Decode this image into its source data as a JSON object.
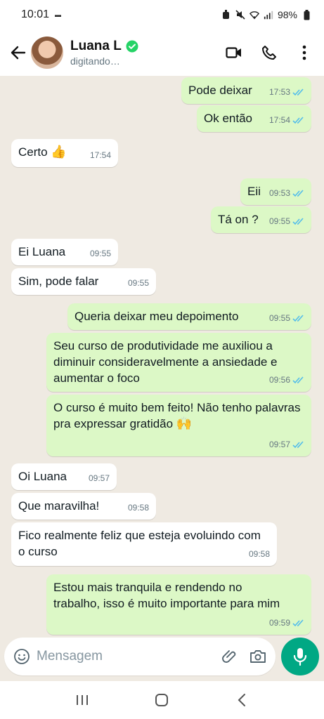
{
  "status_bar": {
    "time": "10:01",
    "battery": "98%",
    "icons": [
      "alarm-icon",
      "mute-icon",
      "wifi-icon",
      "signal-icon",
      "battery-icon"
    ]
  },
  "header": {
    "contact_name": "Luana L",
    "status": "digitando…"
  },
  "messages": [
    {
      "dir": "out",
      "text": "Pode deixar",
      "time": "17:53",
      "read": true
    },
    {
      "dir": "out",
      "text": "Ok então",
      "time": "17:54",
      "read": true
    },
    {
      "dir": "in",
      "text": "Certo",
      "emoji": "👍",
      "time": "17:54"
    },
    {
      "dir": "out",
      "text": "Eii",
      "time": "09:53",
      "read": true
    },
    {
      "dir": "out",
      "text": "Tá on ?",
      "time": "09:55",
      "read": true
    },
    {
      "dir": "in",
      "text": "Ei Luana",
      "time": "09:55"
    },
    {
      "dir": "in",
      "text": "Sim, pode falar",
      "time": "09:55"
    },
    {
      "dir": "out",
      "text": "Queria deixar meu depoimento",
      "time": "09:55",
      "read": true
    },
    {
      "dir": "out",
      "text": "Seu curso de produtividade me auxiliou a diminuir consideravelmente a ansiedade e aumentar o foco",
      "time": "09:56",
      "read": true
    },
    {
      "dir": "out",
      "text": "O curso é muito bem feito! Não tenho palavras pra expressar gratidão",
      "emoji": "🙌",
      "time": "09:57",
      "read": true
    },
    {
      "dir": "in",
      "text": "Oi Luana",
      "time": "09:57"
    },
    {
      "dir": "in",
      "text": "Que maravilha!",
      "time": "09:58"
    },
    {
      "dir": "in",
      "text": "Fico realmente feliz que esteja evoluindo com o curso",
      "time": "09:58"
    },
    {
      "dir": "out",
      "text": "Estou mais tranquila e rendendo no trabalho, isso é muito importante para mim",
      "time": "09:59",
      "read": true
    }
  ],
  "composer": {
    "placeholder": "Mensagem"
  },
  "colors": {
    "chat_bg": "#efeae2",
    "outgoing_bubble": "#dcf8c6",
    "incoming_bubble": "#ffffff",
    "accent": "#00a884",
    "read_check": "#53bdeb",
    "verified": "#25d366"
  }
}
